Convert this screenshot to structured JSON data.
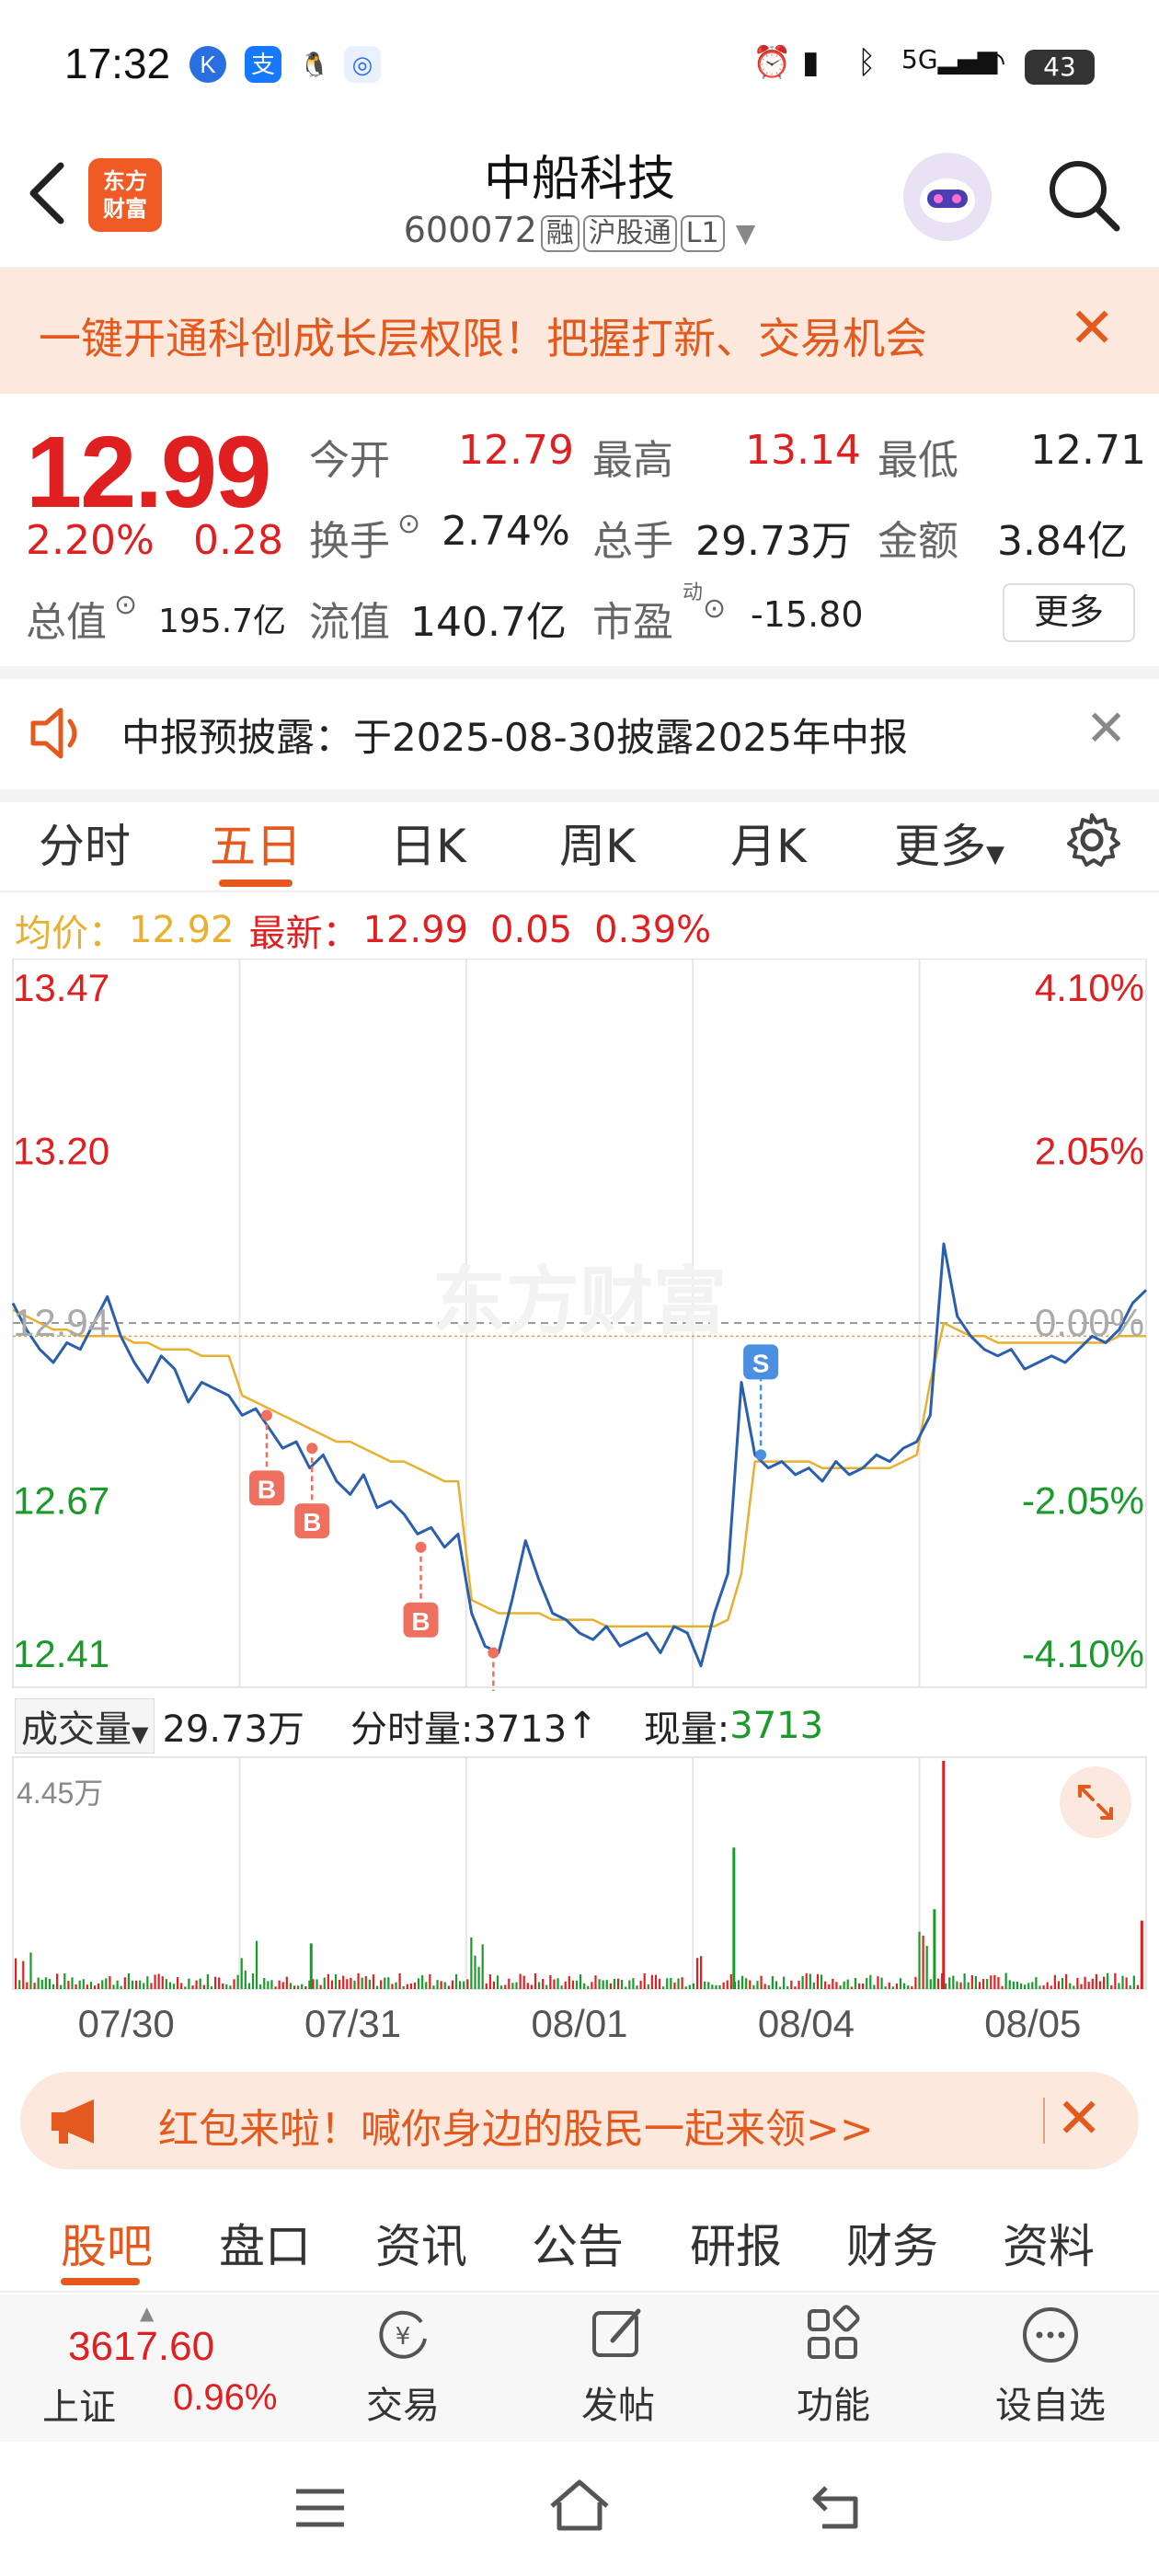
{
  "status_bar": {
    "time": "17:32",
    "battery": "43"
  },
  "header": {
    "title": "中船科技",
    "code": "600072",
    "tags": [
      "融",
      "沪股通",
      "L1"
    ],
    "logo_text": [
      "东方",
      "财富"
    ]
  },
  "banner_top": {
    "text": "一键开通科创成长层权限！把握打新、交易机会"
  },
  "quote": {
    "price": "12.99",
    "change_pct": "2.20%",
    "change": "0.28",
    "open_label": "今开",
    "open": "12.79",
    "high_label": "最高",
    "high": "13.14",
    "low_label": "最低",
    "low": "12.71",
    "turnover_label": "换手",
    "turnover": "2.74%",
    "volume_label": "总手",
    "volume": "29.73万",
    "amount_label": "金额",
    "amount": "3.84亿",
    "mktcap_label": "总值",
    "mktcap": "195.7亿",
    "float_label": "流值",
    "float": "140.7亿",
    "pe_label": "市盈",
    "pe_sup": "动",
    "pe": "-15.80",
    "more": "更多"
  },
  "notice": {
    "text": "中报预披露：于2025-08-30披露2025年中报"
  },
  "tabs": [
    "分时",
    "五日",
    "日K",
    "周K",
    "月K",
    "更多"
  ],
  "info_line": {
    "avg_label": "均价：",
    "avg": "12.92",
    "latest_label": "最新：",
    "latest": "12.99",
    "chg": "0.05",
    "pct": "0.39%"
  },
  "chart_data": {
    "type": "line",
    "title": "",
    "x_labels": [
      "07/30",
      "07/31",
      "08/01",
      "08/04",
      "08/05"
    ],
    "y_left": [
      "13.47",
      "13.20",
      "12.94",
      "12.67",
      "12.41"
    ],
    "y_right": [
      "4.10%",
      "2.05%",
      "0.00%",
      "-2.05%",
      "-4.10%"
    ],
    "ylim": [
      12.41,
      13.47
    ],
    "watermark": "东方财富",
    "markers": [
      {
        "label": "B",
        "day": 1,
        "price": 12.8
      },
      {
        "label": "B",
        "day": 1,
        "price": 12.75
      },
      {
        "label": "B",
        "day": 1,
        "price": 12.6
      },
      {
        "label": "B",
        "day": 2,
        "price": 12.44
      },
      {
        "label": "S",
        "day": 3,
        "price": 12.74
      }
    ],
    "series": [
      {
        "name": "价格",
        "color": "#2a5fb0",
        "values": [
          12.97,
          12.93,
          12.9,
          12.88,
          12.91,
          12.9,
          12.94,
          12.98,
          12.92,
          12.88,
          12.85,
          12.89,
          12.87,
          12.82,
          12.85,
          12.84,
          12.83,
          12.8,
          12.81,
          12.78,
          12.75,
          12.76,
          12.72,
          12.74,
          12.7,
          12.68,
          12.71,
          12.66,
          12.67,
          12.65,
          12.62,
          12.63,
          12.6,
          12.62,
          12.5,
          12.45,
          12.44,
          12.52,
          12.61,
          12.55,
          12.5,
          12.49,
          12.47,
          12.46,
          12.48,
          12.45,
          12.46,
          12.47,
          12.44,
          12.48,
          12.47,
          12.42,
          12.5,
          12.56,
          12.85,
          12.74,
          12.72,
          12.73,
          12.71,
          12.72,
          12.7,
          12.73,
          12.71,
          12.72,
          12.74,
          12.73,
          12.75,
          12.76,
          12.8,
          13.06,
          12.95,
          12.92,
          12.9,
          12.89,
          12.9,
          12.87,
          12.88,
          12.89,
          12.88,
          12.9,
          12.92,
          12.91,
          12.93,
          12.97,
          12.99
        ]
      },
      {
        "name": "均价",
        "color": "#e8b030",
        "values": [
          12.96,
          12.95,
          12.94,
          12.93,
          12.93,
          12.92,
          12.92,
          12.92,
          12.92,
          12.91,
          12.91,
          12.9,
          12.9,
          12.9,
          12.89,
          12.89,
          12.89,
          12.83,
          12.82,
          12.81,
          12.8,
          12.79,
          12.78,
          12.77,
          12.76,
          12.76,
          12.75,
          12.74,
          12.73,
          12.73,
          12.72,
          12.71,
          12.7,
          12.7,
          12.52,
          12.51,
          12.5,
          12.5,
          12.5,
          12.5,
          12.49,
          12.49,
          12.49,
          12.49,
          12.48,
          12.48,
          12.48,
          12.48,
          12.48,
          12.48,
          12.48,
          12.48,
          12.48,
          12.49,
          12.56,
          12.73,
          12.73,
          12.73,
          12.73,
          12.73,
          12.72,
          12.72,
          12.72,
          12.72,
          12.72,
          12.72,
          12.73,
          12.74,
          12.85,
          12.94,
          12.93,
          12.92,
          12.92,
          12.91,
          12.91,
          12.91,
          12.91,
          12.91,
          12.91,
          12.91,
          12.91,
          12.91,
          12.92,
          12.92,
          12.92
        ]
      }
    ],
    "volume": {
      "label": "成交量",
      "total": "29.73万",
      "tick_label": "分时量:3713",
      "now_label": "现量:",
      "now": "3713",
      "max_label": "4.45万",
      "spikes": [
        {
          "pos": 0.635,
          "h": 0.62,
          "color": "#1a9a2a"
        },
        {
          "pos": 0.82,
          "h": 1.0,
          "color": "#e02020"
        },
        {
          "pos": 0.812,
          "h": 0.35,
          "color": "#1a9a2a"
        },
        {
          "pos": 0.262,
          "h": 0.2,
          "color": "#1a9a2a"
        },
        {
          "pos": 0.995,
          "h": 0.3,
          "color": "#e02020"
        }
      ]
    }
  },
  "banner_bottom": {
    "text": "红包来啦！喊你身边的股民一起来领>>"
  },
  "section_tabs": [
    "股吧",
    "盘口",
    "资讯",
    "公告",
    "研报",
    "财务",
    "资料"
  ],
  "toolbar": {
    "index_value": "3617.60",
    "index_name": "上证",
    "index_pct": "0.96%",
    "items": [
      "交易",
      "发帖",
      "功能",
      "设自选"
    ]
  },
  "colors": {
    "accent": "#e45a1e",
    "up": "#e02020",
    "down": "#1a9a2a",
    "price_line": "#2a5fb0",
    "avg_line": "#e8b030"
  }
}
